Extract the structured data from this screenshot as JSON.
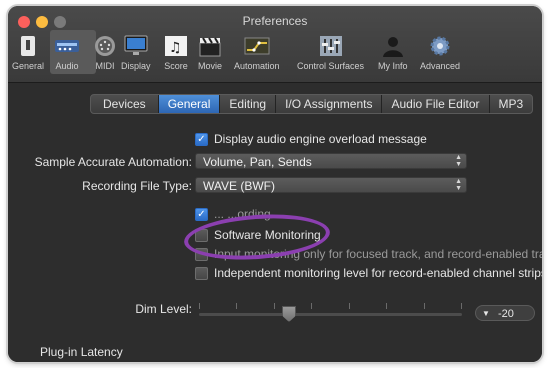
{
  "window": {
    "title": "Preferences"
  },
  "toolbar": {
    "items": [
      {
        "label": "General",
        "icon": "switch-icon"
      },
      {
        "label": "Audio",
        "icon": "audio-interface-icon"
      },
      {
        "label": "MIDI",
        "icon": "midi-connector-icon"
      },
      {
        "label": "Display",
        "icon": "monitor-icon"
      },
      {
        "label": "Score",
        "icon": "music-notes-icon"
      },
      {
        "label": "Movie",
        "icon": "clapperboard-icon"
      },
      {
        "label": "Automation",
        "icon": "automation-curve-icon"
      },
      {
        "label": "Control Surfaces",
        "icon": "mixer-faders-icon"
      },
      {
        "label": "My Info",
        "icon": "person-silhouette-icon"
      },
      {
        "label": "Advanced",
        "icon": "gear-icon"
      }
    ],
    "selected": "Audio"
  },
  "tabs": [
    {
      "label": "Devices"
    },
    {
      "label": "General",
      "active": true
    },
    {
      "label": "Editing"
    },
    {
      "label": "I/O Assignments"
    },
    {
      "label": "Audio File Editor"
    },
    {
      "label": "MP3"
    }
  ],
  "settings": {
    "overload_label": "Display audio engine overload message",
    "automation_label": "Sample Accurate Automation:",
    "automation_value": "Volume, Pan, Sends",
    "file_type_label": "Recording File Type:",
    "file_type_value": "WAVE (BWF)",
    "hidden_row_label": "... ...ording",
    "software_monitoring_label": "Software Monitoring",
    "input_monitoring_label": "Input monitoring only for focused track, and record-enabled tra",
    "independent_label": "Independent monitoring level for record-enabled channel strips",
    "dim_label": "Dim Level:",
    "dim_value": "-20",
    "plugin_latency_label": "Plug-in Latency"
  },
  "colors": {
    "accent": "#3b7fd6",
    "highlight_circle": "#8b3fb0"
  }
}
